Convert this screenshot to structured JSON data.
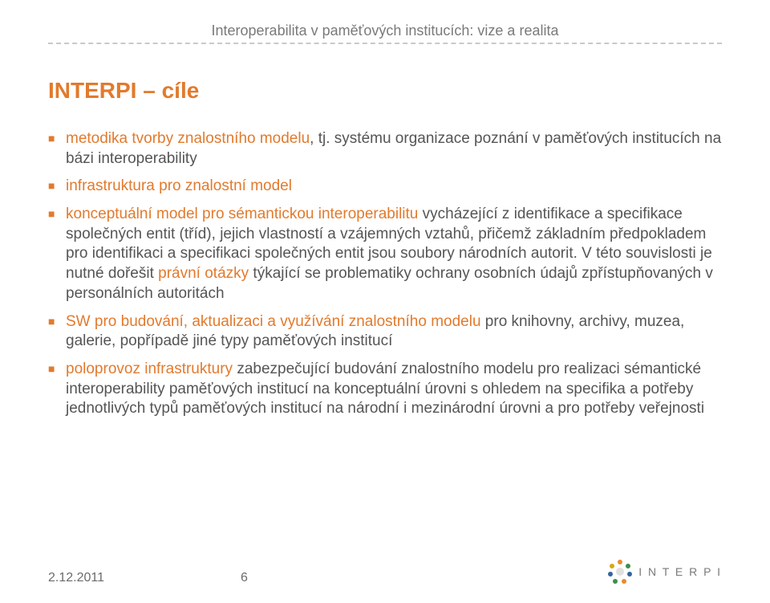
{
  "header_title": "Interoperabilita v paměťových institucích: vize a realita",
  "title": "INTERPI – cíle",
  "bullets": [
    {
      "segments": [
        {
          "text": "metodika tvorby znalostního modelu",
          "hl": true
        },
        {
          "text": ", tj. systému organizace poznání v paměťových institucích na bázi interoperability",
          "hl": false
        }
      ]
    },
    {
      "segments": [
        {
          "text": "infrastruktura pro znalostní model",
          "hl": true
        }
      ]
    },
    {
      "segments": [
        {
          "text": "konceptuální model pro sémantickou interoperabilitu",
          "hl": true
        },
        {
          "text": " vycházející z identifikace a specifikace společných entit (tříd), jejich vlastností a vzájemných vztahů, přičemž základním předpokladem pro identifikaci a specifikaci společných entit jsou soubory národních autorit. V této souvislosti je nutné dořešit ",
          "hl": false
        },
        {
          "text": "právní otázky",
          "hl": true
        },
        {
          "text": " týkající se problematiky ochrany osobních údajů zpřístupňovaných v personálních autoritách",
          "hl": false
        }
      ]
    },
    {
      "segments": [
        {
          "text": "SW pro budování, aktualizaci a využívání znalostního modelu",
          "hl": true
        },
        {
          "text": " pro knihovny, archivy, muzea, galerie, popřípadě jiné typy paměťových institucí",
          "hl": false
        }
      ]
    },
    {
      "segments": [
        {
          "text": "poloprovoz infrastruktury",
          "hl": true
        },
        {
          "text": " zabezpečující budování znalostního modelu pro realizaci sémantické interoperability paměťových institucí na konceptuální úrovni s ohledem na specifika a potřeby jednotlivých typů paměťových institucí na národní i mezinárodní úrovni a pro potřeby veřejnosti",
          "hl": false
        }
      ]
    }
  ],
  "footer": {
    "date": "2.12.2011",
    "page": "6",
    "logo_text": "I N T E R P I"
  }
}
